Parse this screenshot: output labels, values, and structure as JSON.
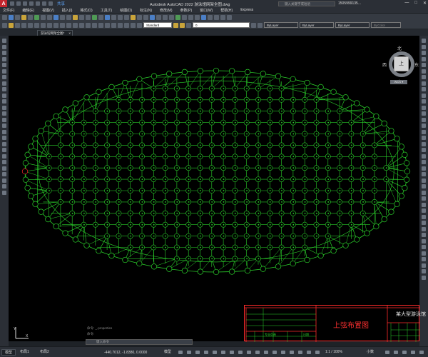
{
  "app": {
    "logo": "A",
    "share_label": "共享",
    "window_title": "Autodesk AutoCAD 2022    游泳馆网架全图.dwg",
    "search_placeholder": "键入关键字或短语",
    "user": "1505999135...",
    "win_min": "—",
    "win_max": "□",
    "win_close": "✕"
  },
  "menu": [
    "文件(F)",
    "编辑(E)",
    "视图(V)",
    "插入(I)",
    "格式(O)",
    "工具(T)",
    "绘图(D)",
    "标注(N)",
    "修改(M)",
    "参数(P)",
    "窗口(W)",
    "帮助(H)",
    "Express"
  ],
  "toolbar2": {
    "text_style": "Standard",
    "layer": "0",
    "color": "ByLayer",
    "linetype": "ByLayer",
    "lineweight": "ByLayer",
    "plotstyle": "ByColor"
  },
  "doc_tab": {
    "label": "游泳馆网架全图*",
    "close": "×"
  },
  "viewcube": {
    "north": "北",
    "south": "南",
    "west": "西",
    "east": "东",
    "top": "上",
    "wcs": "WCS ▾"
  },
  "titleblock": {
    "drawing_title": "上弦布置图",
    "project": "某大型游泳馆",
    "table_header_1": "专业负责",
    "table_header_2": "日期"
  },
  "command": {
    "placeholder": "键入命令",
    "history_1": "命令: _.properties",
    "history_2": "命令:"
  },
  "status": {
    "tabs": [
      "模型",
      "布局1",
      "布局2"
    ],
    "coords": "-440.7012, -1.8380, 0.0000",
    "model_label": "模型",
    "scale": "1:1 / 100%",
    "decimal": "小数"
  },
  "colors": {
    "grid_green": "#2bd12b",
    "selected_red": "#ff2b2b",
    "canvas": "#000000",
    "titleblock_red": "#ff2b2b"
  }
}
